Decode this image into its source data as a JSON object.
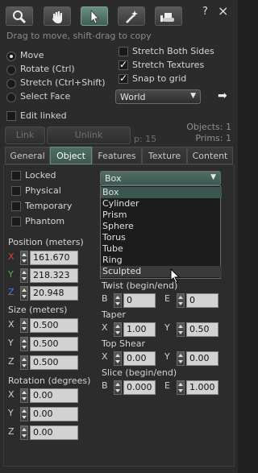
{
  "toolbar": {
    "tools": [
      {
        "name": "focus-tool",
        "icon": "magnifier-icon",
        "selected": false
      },
      {
        "name": "move-tool",
        "icon": "hand-icon",
        "selected": false
      },
      {
        "name": "edit-tool",
        "icon": "arrow-cursor-icon",
        "selected": true
      },
      {
        "name": "create-tool",
        "icon": "magic-wand-icon",
        "selected": false
      },
      {
        "name": "land-tool",
        "icon": "bulldozer-icon",
        "selected": false
      }
    ],
    "help_label": "?",
    "close_label": "×",
    "hint": "Drag to move, shift-drag to copy"
  },
  "edit_modes": {
    "move": "Move",
    "rotate": "Rotate (Ctrl)",
    "stretch": "Stretch (Ctrl+Shift)",
    "select_face": "Select Face",
    "selected": "Move"
  },
  "options": {
    "stretch_both_sides": {
      "label": "Stretch Both Sides",
      "checked": false
    },
    "stretch_textures": {
      "label": "Stretch Textures",
      "checked": true
    },
    "snap_to_grid": {
      "label": "Snap to grid",
      "checked": true
    },
    "grid_mode": "World"
  },
  "edit_linked": {
    "label": "Edit linked",
    "checked": false
  },
  "link_button": "Link",
  "unlink_button": "Unlink",
  "partial_label": "p: 15",
  "counts": {
    "objects": "Objects: 1",
    "prims": "Prims: 1"
  },
  "tabs": [
    "General",
    "Object",
    "Features",
    "Texture",
    "Content"
  ],
  "active_tab": "Object",
  "object": {
    "locked": "Locked",
    "physical": "Physical",
    "temporary": "Temporary",
    "phantom": "Phantom",
    "position_label": "Position (meters)",
    "position": {
      "x": "161.670",
      "y": "218.323",
      "z": "20.948"
    },
    "size_label": "Size (meters)",
    "size": {
      "x": "0.500",
      "y": "0.500",
      "z": "0.500"
    },
    "rotation_label": "Rotation (degrees)",
    "rotation": {
      "x": "0.00",
      "y": "0.00",
      "z": "0.00"
    },
    "axis_x": "X",
    "axis_y": "Y",
    "axis_z": "Z",
    "shape_selected": "Box",
    "shape_options": [
      "Box",
      "Cylinder",
      "Prism",
      "Sphere",
      "Torus",
      "Tube",
      "Ring",
      "Sculpted"
    ],
    "twist_label": "Twist (begin/end)",
    "twist": {
      "b": "0",
      "e": "0"
    },
    "taper_label": "Taper",
    "taper": {
      "x": "1.00",
      "y": "0.50"
    },
    "top_shear_label": "Top Shear",
    "top_shear": {
      "x": "0.00",
      "y": "0.00"
    },
    "slice_label": "Slice (begin/end)",
    "slice": {
      "b": "0.000",
      "e": "1.000"
    },
    "label_b": "B",
    "label_e": "E"
  },
  "colors": {
    "accent": "#4f6e66",
    "axis_x": "#e04040",
    "axis_y": "#40c040",
    "axis_z": "#4080e0"
  }
}
